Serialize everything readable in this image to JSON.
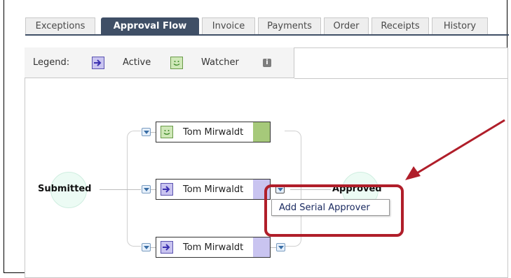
{
  "tabs": [
    {
      "label": "Exceptions",
      "active": false
    },
    {
      "label": "Approval Flow",
      "active": true
    },
    {
      "label": "Invoice",
      "active": false
    },
    {
      "label": "Payments",
      "active": false
    },
    {
      "label": "Order",
      "active": false
    },
    {
      "label": "Receipts",
      "active": false
    },
    {
      "label": "History",
      "active": false
    }
  ],
  "legend": {
    "title": "Legend:",
    "active_label": "Active",
    "watcher_label": "Watcher",
    "active_icon": "arrow-right-icon",
    "watcher_icon": "smiley-icon",
    "info_icon": "info-icon"
  },
  "flow": {
    "start_label": "Submitted",
    "end_label": "Approved",
    "approvers": [
      {
        "name": "Tom Mirwaldt",
        "role": "watcher",
        "icon": "smiley-icon"
      },
      {
        "name": "Tom Mirwaldt",
        "role": "active",
        "icon": "arrow-right-icon"
      },
      {
        "name": "Tom Mirwaldt",
        "role": "active",
        "icon": "arrow-right-icon"
      }
    ]
  },
  "context_menu": {
    "items": [
      "Add Serial Approver"
    ]
  },
  "colors": {
    "tab_active": "#3f4f66",
    "active_fill": "#c9c4f0",
    "watcher_fill": "#a6c97a",
    "annotation": "#b01e2a"
  }
}
